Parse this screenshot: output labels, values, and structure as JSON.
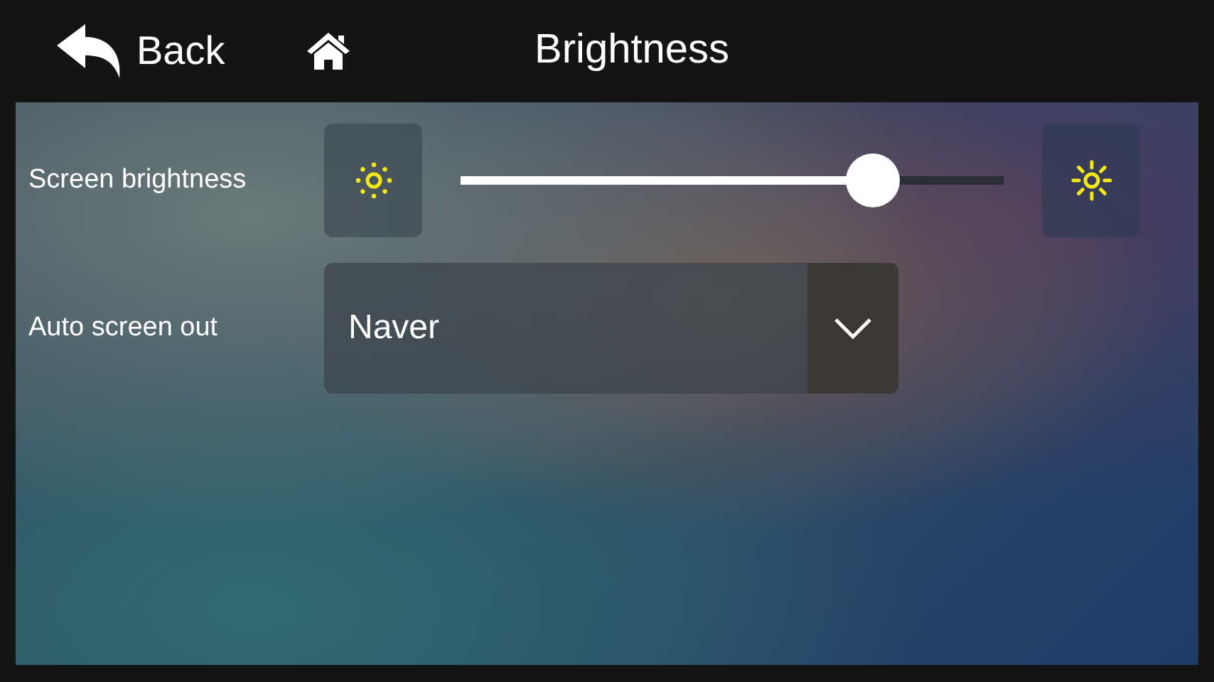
{
  "header": {
    "back": "Back",
    "title": "Brightness"
  },
  "settings": [
    {
      "kind": "slider",
      "label": "Screen brightness",
      "level": 0.76
    },
    {
      "kind": "dropdown",
      "label": "Auto screen out",
      "value": "Naver"
    }
  ]
}
